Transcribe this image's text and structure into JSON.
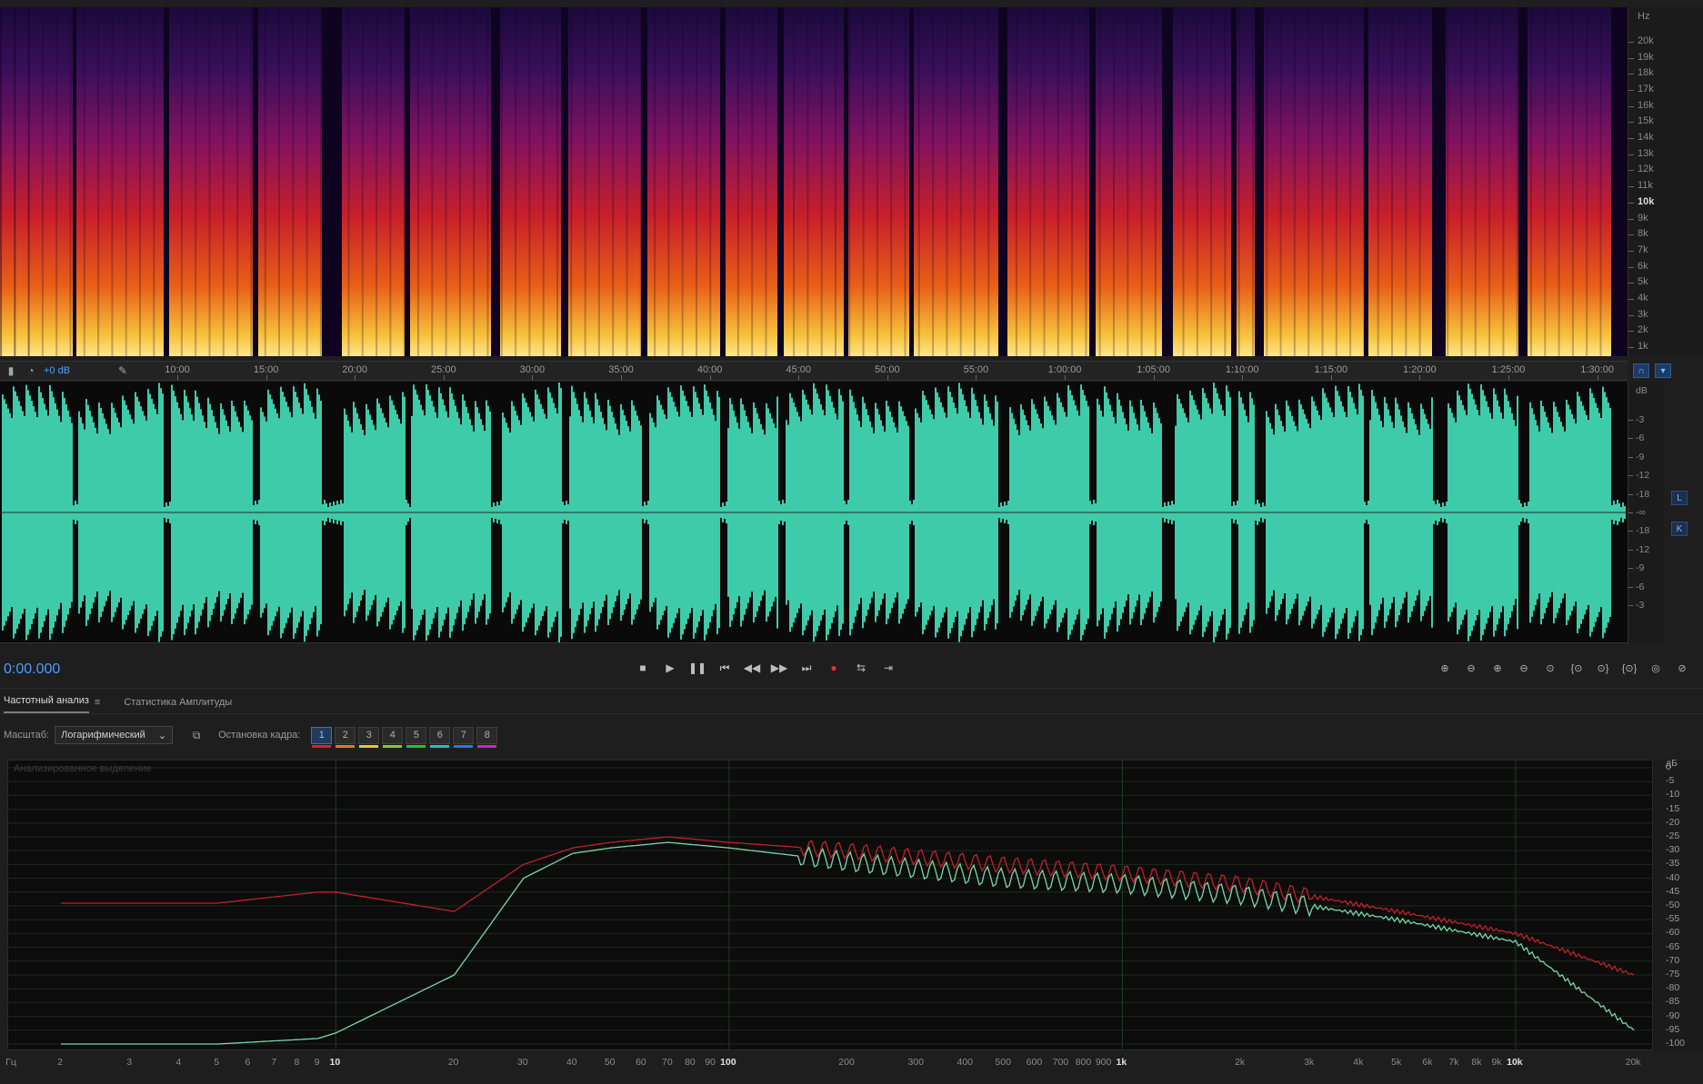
{
  "spectral": {
    "unit_label": "Hz",
    "freq_labels": [
      "20k",
      "19k",
      "18k",
      "17k",
      "16k",
      "15k",
      "14k",
      "13k",
      "12k",
      "11k",
      "10k",
      "9k",
      "8k",
      "7k",
      "6k",
      "5k",
      "4k",
      "3k",
      "2k",
      "1k"
    ]
  },
  "time_ruler": {
    "gain_label": "+0 dB",
    "labels": [
      "10:00",
      "15:00",
      "20:00",
      "25:00",
      "30:00",
      "35:00",
      "40:00",
      "45:00",
      "50:00",
      "55:00",
      "1:00:00",
      "1:05:00",
      "1:10:00",
      "1:15:00",
      "1:20:00",
      "1:25:00",
      "1:30:00"
    ]
  },
  "waveform": {
    "db_unit": "dB",
    "db_labels": [
      "-3",
      "-6",
      "-9",
      "-12",
      "-18",
      "-∞",
      "-18",
      "-12",
      "-9",
      "-6",
      "-3"
    ],
    "channel_left": "L",
    "channel_right": "K",
    "color": "#3ecba9"
  },
  "transport": {
    "timecode": "0:00.000",
    "controls": [
      "stop-icon",
      "play-icon",
      "pause-icon",
      "go-start-icon",
      "rewind-icon",
      "fast-forward-icon",
      "go-end-icon",
      "record-icon",
      "loop-icon",
      "skip-selection-icon"
    ],
    "zoom_tools": [
      "zoom-in-amplitude-icon",
      "zoom-out-amplitude-icon",
      "zoom-in-time-icon",
      "zoom-out-time-icon",
      "zoom-full-icon",
      "zoom-in-left-icon",
      "zoom-in-right-icon",
      "zoom-out-full-icon",
      "zoom-selection-icon",
      "zoom-tracks-icon"
    ]
  },
  "panel": {
    "tab_active": "Частотный анализ",
    "tab_other": "Статистика Амплитуды",
    "scale_label": "Масштаб:",
    "scale_value": "Логарифмический",
    "freeze_label": "Остановка кадра:",
    "frames": [
      {
        "n": "1",
        "color": "#e02020"
      },
      {
        "n": "2",
        "color": "#e07a20"
      },
      {
        "n": "3",
        "color": "#e0d020"
      },
      {
        "n": "4",
        "color": "#7ad020"
      },
      {
        "n": "5",
        "color": "#20c040"
      },
      {
        "n": "6",
        "color": "#20c0c0"
      },
      {
        "n": "7",
        "color": "#2a7ae0"
      },
      {
        "n": "8",
        "color": "#d020d0"
      }
    ]
  },
  "graph": {
    "title": "Анализированное выделение",
    "db_unit": "дБ",
    "db_labels": [
      "0",
      "-5",
      "-10",
      "-15",
      "-20",
      "-25",
      "-30",
      "-35",
      "-40",
      "-45",
      "-50",
      "-55",
      "-60",
      "-65",
      "-70",
      "-75",
      "-80",
      "-85",
      "-90",
      "-95",
      "-100"
    ],
    "x_unit": "Гц",
    "x_labels": [
      "2",
      "3",
      "4",
      "5",
      "6",
      "7",
      "8",
      "9",
      "10",
      "20",
      "30",
      "40",
      "50",
      "60",
      "70",
      "80",
      "90",
      "100",
      "200",
      "300",
      "400",
      "500",
      "600",
      "700",
      "800",
      "900",
      "1k",
      "2k",
      "3k",
      "4k",
      "5k",
      "6k",
      "7k",
      "8k",
      "9k",
      "10k",
      "20k"
    ]
  },
  "chart_data": {
    "type": "line",
    "xlabel": "Гц",
    "ylabel": "дБ",
    "xscale": "log",
    "ylim": [
      -100,
      0
    ],
    "x": [
      2,
      5,
      9,
      10,
      20,
      30,
      40,
      50,
      70,
      100,
      200,
      500,
      1000,
      2000,
      5000,
      10000,
      20000
    ],
    "series": [
      {
        "color": "#c0202a",
        "values": [
          -49,
          -49,
          -45,
          -45,
          -52,
          -35,
          -29,
          -27,
          -25,
          -27,
          -30,
          -35,
          -38,
          -42,
          -52,
          -60,
          -75
        ]
      },
      {
        "color": "#7ad8a8",
        "values": [
          -100,
          -100,
          -98,
          -96,
          -75,
          -40,
          -31,
          -29,
          -27,
          -29,
          -34,
          -40,
          -42,
          -46,
          -55,
          -63,
          -95
        ]
      }
    ]
  }
}
